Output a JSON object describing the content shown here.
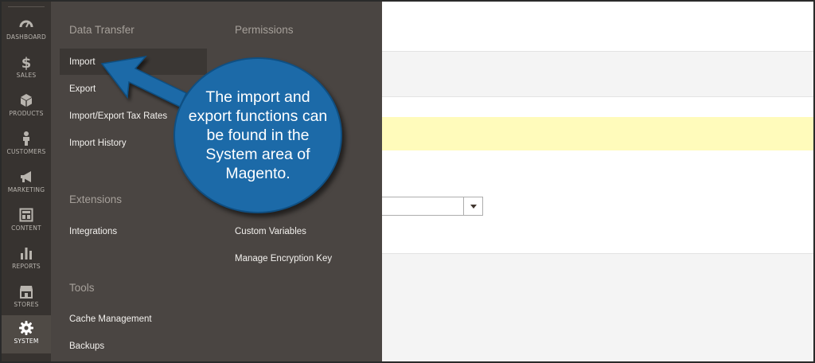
{
  "nav": {
    "items": [
      {
        "label": "DASHBOARD",
        "icon": "dashboard-gauge-icon"
      },
      {
        "label": "SALES",
        "icon": "dollar-icon"
      },
      {
        "label": "PRODUCTS",
        "icon": "cube-icon"
      },
      {
        "label": "CUSTOMERS",
        "icon": "person-icon"
      },
      {
        "label": "MARKETING",
        "icon": "megaphone-icon"
      },
      {
        "label": "CONTENT",
        "icon": "layout-icon"
      },
      {
        "label": "REPORTS",
        "icon": "bar-chart-icon"
      },
      {
        "label": "STORES",
        "icon": "storefront-icon"
      },
      {
        "label": "SYSTEM",
        "icon": "gear-icon"
      }
    ],
    "active": "SYSTEM"
  },
  "panel": {
    "data_transfer": {
      "title": "Data Transfer",
      "items": [
        "Import",
        "Export",
        "Import/Export Tax Rates",
        "Import History"
      ],
      "selected": "Import"
    },
    "extensions": {
      "title": "Extensions",
      "items": [
        "Integrations"
      ]
    },
    "tools": {
      "title": "Tools",
      "items": [
        "Cache Management",
        "Backups"
      ]
    },
    "permissions": {
      "title": "Permissions"
    },
    "other_settings": {
      "items": [
        "Custom Variables",
        "Manage Encryption Key"
      ]
    }
  },
  "callout": {
    "text": "The import and export functions can be found in the System area of Magento.",
    "color": "#1c6aa8"
  },
  "colors": {
    "nav_bg": "#373330",
    "panel_bg": "#4a4542",
    "notice_yellow": "#fffbbb"
  }
}
